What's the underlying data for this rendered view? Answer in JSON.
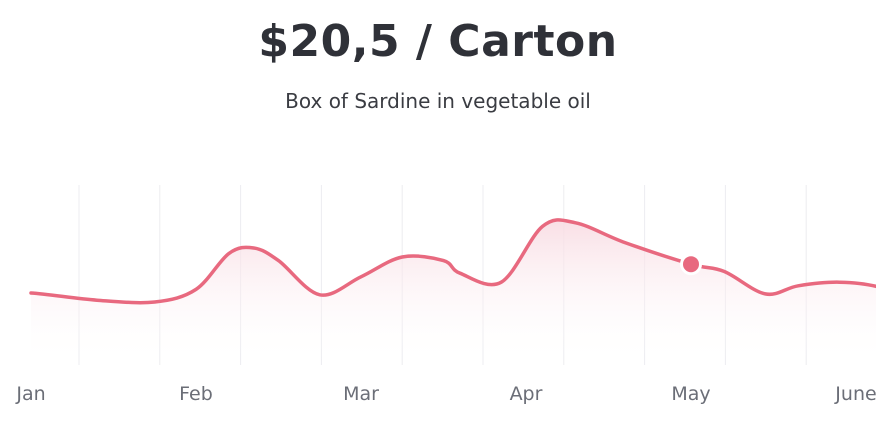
{
  "header": {
    "price": "$20,5 / Carton",
    "product": "Box of Sardine in vegetable oil"
  },
  "colors": {
    "line": "#e8697f",
    "fill_top": "#f8dbe2",
    "highlight_point": "#e8697f",
    "title": "#2f3138",
    "grid": "#ececf0"
  },
  "chart_data": {
    "type": "area",
    "title": "",
    "xlabel": "",
    "ylabel": "",
    "x_labels": [
      "Jan",
      "Feb",
      "Mar",
      "Apr",
      "May",
      "June"
    ],
    "x": [
      0,
      0.4,
      0.75,
      1,
      1.2,
      1.35,
      1.5,
      1.75,
      2,
      2.25,
      2.5,
      2.6,
      2.85,
      3.1,
      3.3,
      3.6,
      4,
      4.2,
      4.45,
      4.65,
      4.9,
      5.15,
      5.3
    ],
    "y": [
      4.0,
      3.6,
      3.5,
      4.2,
      6.2,
      6.5,
      5.8,
      3.9,
      4.9,
      6.0,
      5.8,
      5.1,
      4.6,
      7.7,
      7.9,
      6.8,
      5.6,
      5.2,
      3.95,
      4.4,
      4.6,
      4.3,
      3.5
    ],
    "highlight": {
      "x": 4.0,
      "y": 5.6
    },
    "ylim": [
      0,
      10
    ],
    "grid": "vertical",
    "legend": "none"
  }
}
